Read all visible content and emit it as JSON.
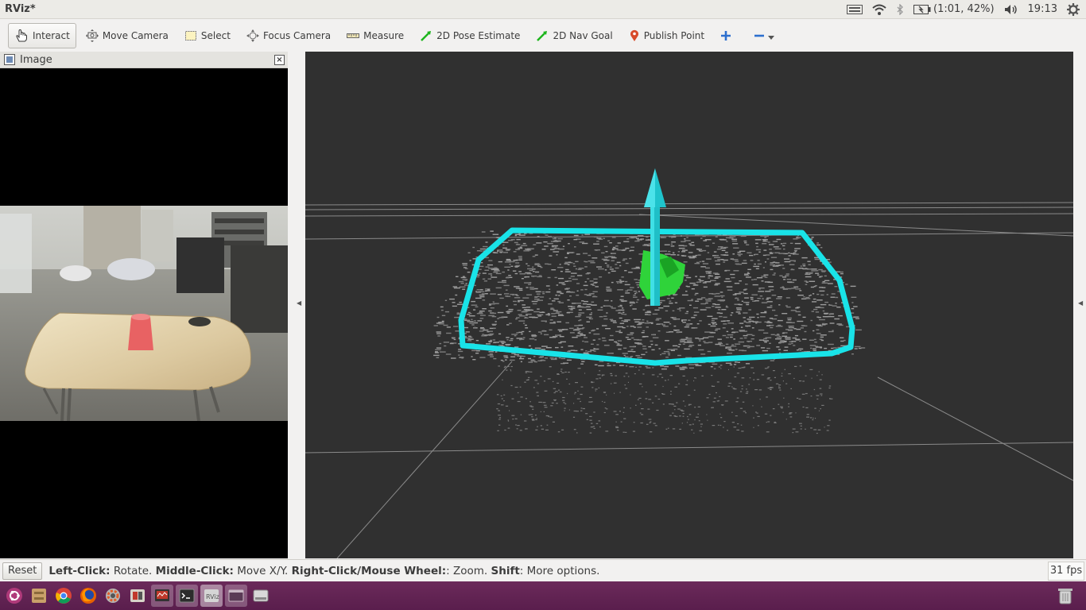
{
  "window": {
    "title": "RViz*"
  },
  "system_tray": {
    "battery": "(1:01, 42%)",
    "clock": "19:13"
  },
  "toolbar": {
    "tools": [
      {
        "label": "Interact",
        "icon": "hand-icon",
        "active": true
      },
      {
        "label": "Move Camera",
        "icon": "move-camera-icon",
        "active": false
      },
      {
        "label": "Select",
        "icon": "select-icon",
        "active": false
      },
      {
        "label": "Focus Camera",
        "icon": "focus-camera-icon",
        "active": false
      },
      {
        "label": "Measure",
        "icon": "ruler-icon",
        "active": false
      },
      {
        "label": "2D Pose Estimate",
        "icon": "green-arrow-icon",
        "active": false
      },
      {
        "label": "2D Nav Goal",
        "icon": "green-arrow-icon",
        "active": false
      },
      {
        "label": "Publish Point",
        "icon": "map-pin-icon",
        "active": false
      }
    ]
  },
  "image_panel": {
    "title": "Image"
  },
  "status": {
    "reset_label": "Reset",
    "hint_left_key": "Left-Click:",
    "hint_left_val": " Rotate. ",
    "hint_middle_key": "Middle-Click:",
    "hint_middle_val": " Move X/Y. ",
    "hint_right_key": "Right-Click/Mouse Wheel:",
    "hint_right_val": ": Zoom. ",
    "hint_shift_key": "Shift",
    "hint_shift_val": ": More options.",
    "fps": "31 fps"
  },
  "colors": {
    "background_3d": "#303030",
    "polygon": "#19e3e8",
    "arrow": "#1fc4cc",
    "cluster": "#2fd33a",
    "taskbar": "#5a1e4d"
  }
}
